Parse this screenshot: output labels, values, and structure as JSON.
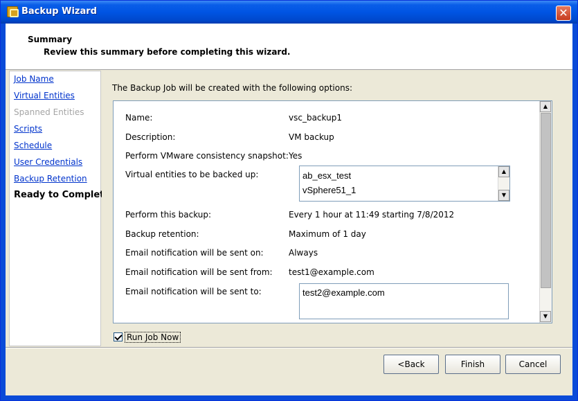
{
  "window": {
    "title": "Backup Wizard",
    "close_glyph": "✕"
  },
  "header": {
    "title": "Summary",
    "subtitle": "Review this summary before completing this wizard."
  },
  "nav": {
    "items": [
      {
        "label": "Job Name",
        "state": "link"
      },
      {
        "label": "Virtual Entities",
        "state": "link"
      },
      {
        "label": "Spanned Entities",
        "state": "disabled"
      },
      {
        "label": "Scripts",
        "state": "link"
      },
      {
        "label": "Schedule",
        "state": "link"
      },
      {
        "label": "User Credentials",
        "state": "link"
      },
      {
        "label": "Backup Retention",
        "state": "link"
      },
      {
        "label": "Ready to Complete",
        "state": "current"
      }
    ]
  },
  "summary": {
    "intro": "The Backup Job will be created with the following options:",
    "rows": [
      {
        "label": "Name:",
        "value": "vsc_backup1"
      },
      {
        "label": "Description:",
        "value": "VM backup"
      },
      {
        "label": "Perform VMware consistency snapshot:",
        "value": "Yes"
      },
      {
        "label": "Virtual entities to be backed up:",
        "value": ""
      },
      {
        "label": "Perform this backup:",
        "value": "Every 1 hour at 11:49 starting 7/8/2012"
      },
      {
        "label": "Backup retention:",
        "value": "Maximum of 1 day"
      },
      {
        "label": "Email notification will be sent on:",
        "value": "Always"
      },
      {
        "label": "Email notification will be sent from:",
        "value": "test1@example.com"
      },
      {
        "label": "Email notification will be sent to:",
        "value": ""
      }
    ],
    "entities": [
      "ab_esx_test",
      "vSphere51_1"
    ],
    "email_to": "test2@example.com"
  },
  "run_job_now": {
    "label": "Run Job Now",
    "checked": true
  },
  "buttons": {
    "back": "<Back",
    "finish": "Finish",
    "cancel": "Cancel"
  },
  "colors": {
    "titlebar": "#0054e3",
    "link": "#0033cc",
    "disabled": "#a5a5a5",
    "frame": "#ece9d8"
  }
}
